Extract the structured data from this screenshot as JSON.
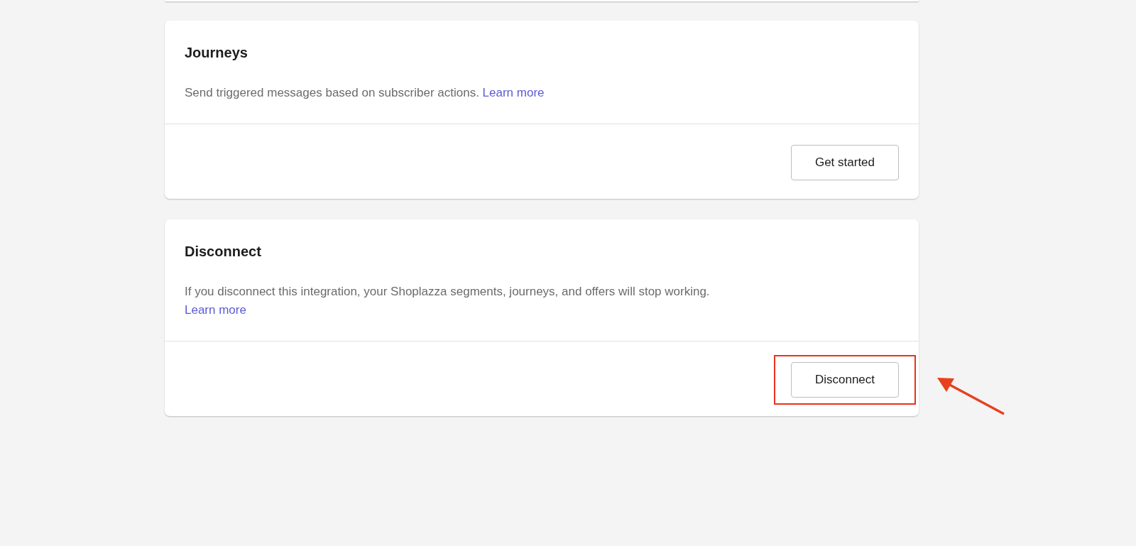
{
  "cards": [
    {
      "title": "Journeys",
      "description": "Send triggered messages based on subscriber actions.",
      "link": "Learn more",
      "link_on_new_line": false,
      "button": "Get started",
      "highlighted": false
    },
    {
      "title": "Disconnect",
      "description": "If you disconnect this integration, your Shoplazza segments, journeys, and offers will stop working.",
      "link": "Learn more",
      "link_on_new_line": true,
      "button": "Disconnect",
      "highlighted": true
    }
  ]
}
